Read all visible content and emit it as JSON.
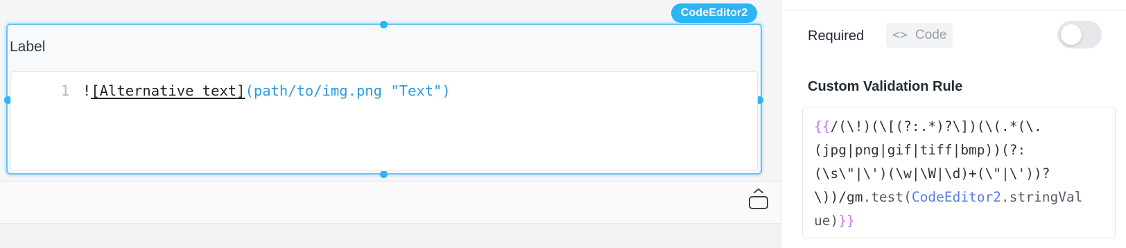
{
  "canvas": {
    "widget_tag": "CodeEditor2",
    "field_label": "Label",
    "editor": {
      "line_number": "1",
      "code_bang": "!",
      "code_alt": "[Alternative text]",
      "code_url": "(path/to/img.png \"Text\")"
    },
    "collapse_icon": "expand-collapse-icon"
  },
  "panel": {
    "required_label": "Required",
    "code_button": {
      "icon": "code-brackets-icon",
      "label": "Code"
    },
    "required_toggle": {
      "on": false
    },
    "validation_label": "Custom Validation Rule",
    "validation_rule": {
      "line1_open": "{{",
      "line1_rest": "/(\\!)(\\[(?:.*)?\\])(\\(.*(\\.",
      "line2": "(jpg|png|gif|tiff|bmp))(?:",
      "line3": "(\\s\\\"|\\')(\\w|\\W|\\d)+(\\\"|\\'))?",
      "line4_a": "\\))/gm",
      "line4_dot_test": ".test(",
      "line4_ref": "CodeEditor2",
      "line4_tail": ".stringVal",
      "line5_a": "ue)",
      "line5_close": "}}"
    }
  },
  "colors": {
    "accent": "#2db4f5",
    "url": "#2a9be0",
    "brace": "#c17be0",
    "reference": "#5b7be0"
  }
}
